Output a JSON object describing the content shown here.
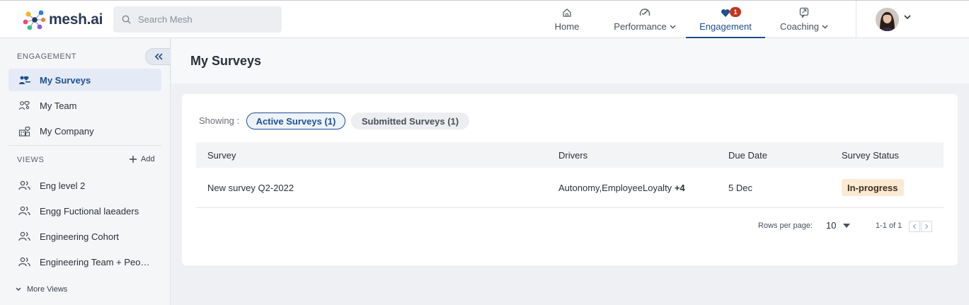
{
  "brand": {
    "name": "mesh.ai"
  },
  "search": {
    "placeholder": "Search Mesh"
  },
  "nav": [
    {
      "label": "Home",
      "icon": "home-icon"
    },
    {
      "label": "Performance",
      "icon": "performance-icon",
      "has_dropdown": true
    },
    {
      "label": "Engagement",
      "icon": "engagement-icon",
      "badge": "1",
      "active": true
    },
    {
      "label": "Coaching",
      "icon": "coaching-icon",
      "has_dropdown": true
    }
  ],
  "sidebar": {
    "section_title": "ENGAGEMENT",
    "items": [
      {
        "label": "My Surveys",
        "icon": "surveys-icon",
        "active": true
      },
      {
        "label": "My Team",
        "icon": "team-icon"
      },
      {
        "label": "My Company",
        "icon": "company-icon"
      }
    ],
    "views_title": "VIEWS",
    "add_label": "Add",
    "views": [
      {
        "label": "Eng level 2",
        "icon": "people-icon"
      },
      {
        "label": "Engg Fuctional laeaders",
        "icon": "people-icon"
      },
      {
        "label": "Engineering Cohort",
        "icon": "people-icon"
      },
      {
        "label": "Engineering Team + Peo…",
        "icon": "people-icon"
      }
    ],
    "more_views": "More Views"
  },
  "page": {
    "title": "My Surveys"
  },
  "filters": {
    "showing_label": "Showing :",
    "active_tab": "Active Surveys (1)",
    "submitted_tab": "Submitted Surveys (1)"
  },
  "table": {
    "columns": [
      "Survey",
      "Drivers",
      "Due Date",
      "Survey Status"
    ],
    "rows": [
      {
        "survey": "New survey Q2-2022",
        "drivers": "Autonomy,EmployeeLoyalty",
        "drivers_more": "+4",
        "due": "5 Dec",
        "status": "In-progress"
      }
    ]
  },
  "pagination": {
    "rows_per_page_label": "Rows per page:",
    "rows_per_page": "10",
    "range": "1-1 of 1"
  },
  "colors": {
    "accent": "#1d4f91",
    "badge": "#c4361f",
    "status_bg": "#fbead3"
  }
}
